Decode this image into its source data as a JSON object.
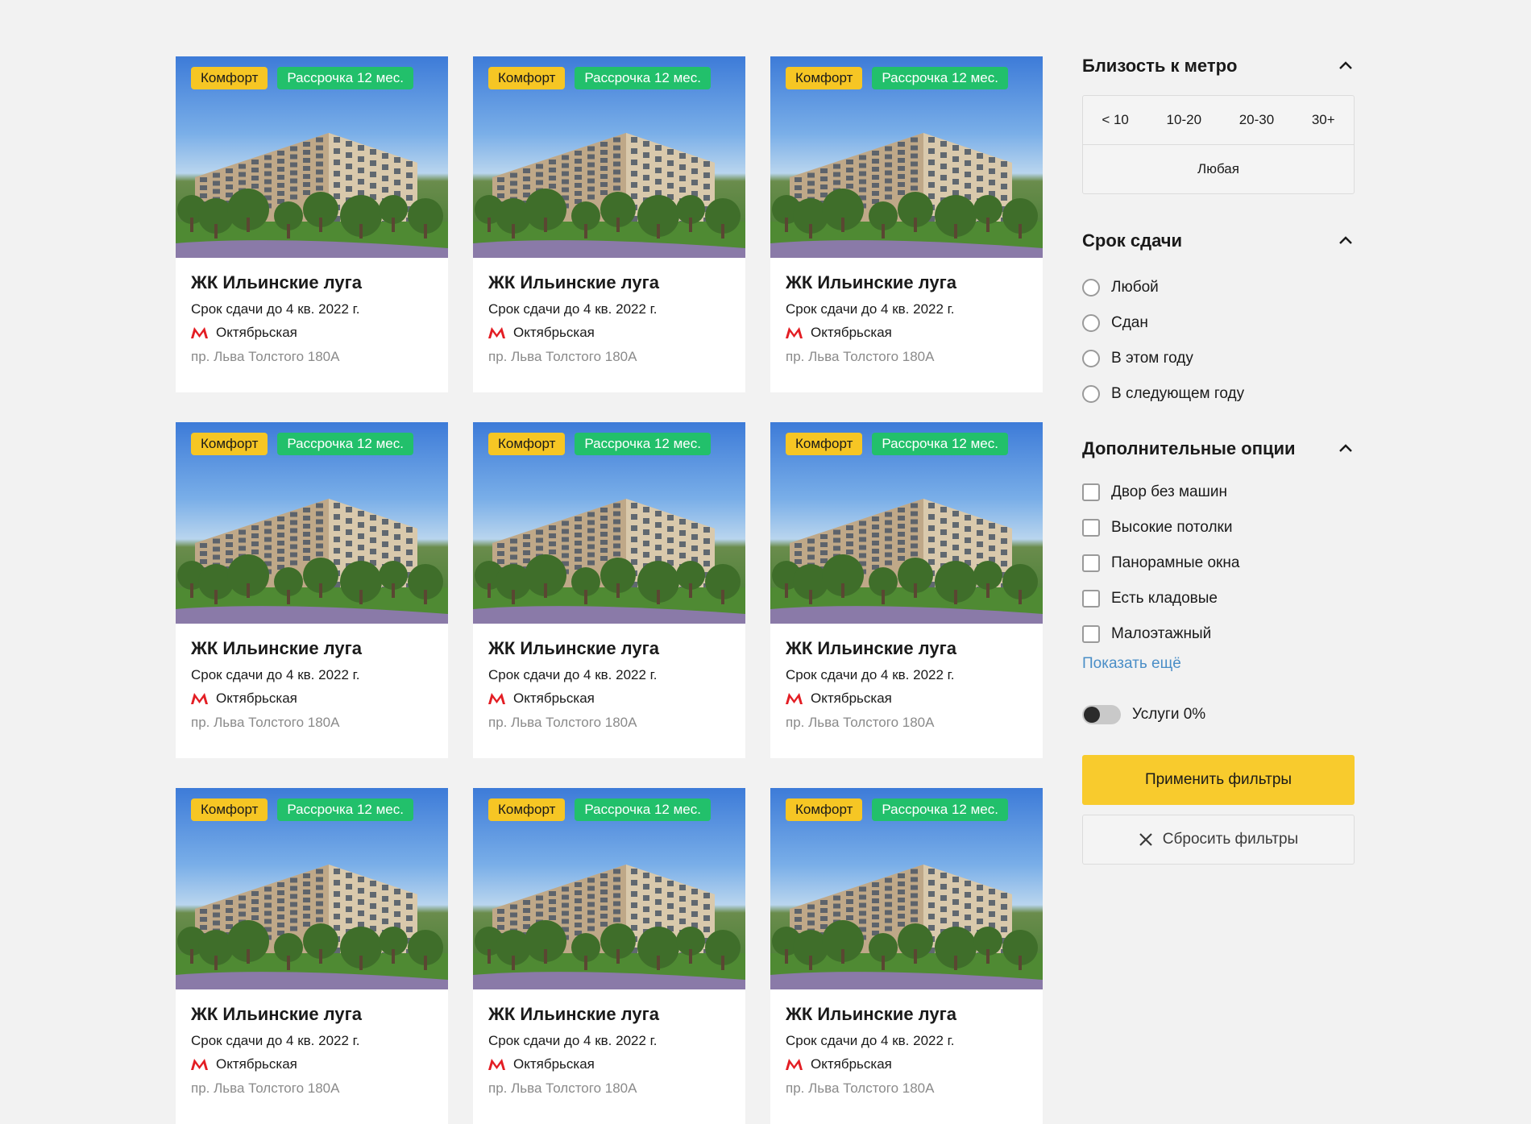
{
  "colors": {
    "background": "#f2f2f2",
    "tag_comfort": "#f6c624",
    "tag_installment": "#22c06b",
    "metro_brand": "#e31e24",
    "link": "#4a8ec7",
    "apply_button": "#f8cb2d"
  },
  "listings": [
    {
      "tag_class": "Комфорт",
      "tag_payment": "Рассрочка 12 мес.",
      "title": "ЖК Ильинские луга",
      "deadline": "Срок сдачи до 4 кв. 2022 г.",
      "metro_icon": "metro-logo-icon",
      "metro": "Октябрьская",
      "address": "пр. Льва Толстого 180А"
    },
    {
      "tag_class": "Комфорт",
      "tag_payment": "Рассрочка 12 мес.",
      "title": "ЖК Ильинские луга",
      "deadline": "Срок сдачи до 4 кв. 2022 г.",
      "metro_icon": "metro-logo-icon",
      "metro": "Октябрьская",
      "address": "пр. Льва Толстого 180А"
    },
    {
      "tag_class": "Комфорт",
      "tag_payment": "Рассрочка 12 мес.",
      "title": "ЖК Ильинские луга",
      "deadline": "Срок сдачи до 4 кв. 2022 г.",
      "metro_icon": "metro-logo-icon",
      "metro": "Октябрьская",
      "address": "пр. Льва Толстого 180А"
    },
    {
      "tag_class": "Комфорт",
      "tag_payment": "Рассрочка 12 мес.",
      "title": "ЖК Ильинские луга",
      "deadline": "Срок сдачи до 4 кв. 2022 г.",
      "metro_icon": "metro-logo-icon",
      "metro": "Октябрьская",
      "address": "пр. Льва Толстого 180А"
    },
    {
      "tag_class": "Комфорт",
      "tag_payment": "Рассрочка 12 мес.",
      "title": "ЖК Ильинские луга",
      "deadline": "Срок сдачи до 4 кв. 2022 г.",
      "metro_icon": "metro-logo-icon",
      "metro": "Октябрьская",
      "address": "пр. Льва Толстого 180А"
    },
    {
      "tag_class": "Комфорт",
      "tag_payment": "Рассрочка 12 мес.",
      "title": "ЖК Ильинские луга",
      "deadline": "Срок сдачи до 4 кв. 2022 г.",
      "metro_icon": "metro-logo-icon",
      "metro": "Октябрьская",
      "address": "пр. Льва Толстого 180А"
    },
    {
      "tag_class": "Комфорт",
      "tag_payment": "Рассрочка 12 мес.",
      "title": "ЖК Ильинские луга",
      "deadline": "Срок сдачи до 4 кв. 2022 г.",
      "metro_icon": "metro-logo-icon",
      "metro": "Октябрьская",
      "address": "пр. Льва Толстого 180А"
    },
    {
      "tag_class": "Комфорт",
      "tag_payment": "Рассрочка 12 мес.",
      "title": "ЖК Ильинские луга",
      "deadline": "Срок сдачи до 4 кв. 2022 г.",
      "metro_icon": "metro-logo-icon",
      "metro": "Октябрьская",
      "address": "пр. Льва Толстого 180А"
    },
    {
      "tag_class": "Комфорт",
      "tag_payment": "Рассрочка 12 мес.",
      "title": "ЖК Ильинские луга",
      "deadline": "Срок сдачи до 4 кв. 2022 г.",
      "metro_icon": "metro-logo-icon",
      "metro": "Октябрьская",
      "address": "пр. Льва Толстого 180А"
    }
  ],
  "filters": {
    "metro_proximity": {
      "title": "Близость к метро",
      "options": [
        "< 10",
        "10-20",
        "20-30",
        "30+"
      ],
      "any": "Любая"
    },
    "deadline": {
      "title": "Срок сдачи",
      "options": [
        "Любой",
        "Сдан",
        "В этом году",
        "В следующем году"
      ]
    },
    "extra_options": {
      "title": "Дополнительные опции",
      "options": [
        "Двор без машин",
        "Высокие потолки",
        "Панорамные окна",
        "Есть кладовые",
        "Малоэтажный"
      ],
      "show_more": "Показать ещё"
    },
    "services_toggle": {
      "label": "Услуги 0%",
      "on": false
    },
    "apply_label": "Применить фильтры",
    "reset_label": "Сбросить фильтры"
  }
}
